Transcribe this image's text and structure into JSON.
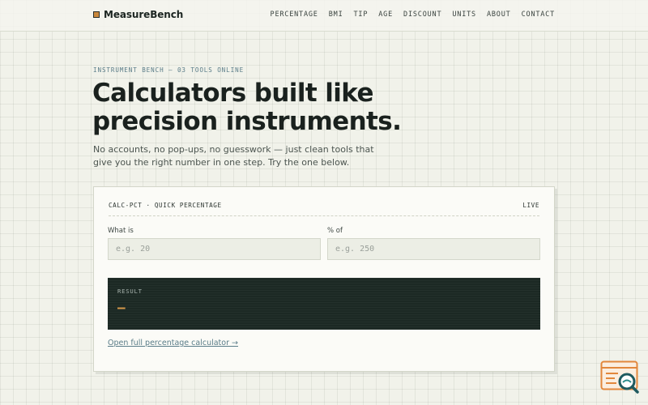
{
  "brand": {
    "name": "MeasureBench"
  },
  "nav": {
    "items": [
      "PERCENTAGE",
      "BMI",
      "TIP",
      "AGE",
      "DISCOUNT",
      "UNITS",
      "ABOUT",
      "CONTACT"
    ]
  },
  "hero": {
    "eyebrow": "INSTRUMENT BENCH — 03 TOOLS ONLINE",
    "headline": "Calculators built like precision instruments.",
    "subtext": "No accounts, no pop-ups, no guesswork — just clean tools that give you the right number in one step. Try the one below."
  },
  "calculator": {
    "id_label": "CALC-PCT · QUICK PERCENTAGE",
    "status": "LIVE",
    "field1": {
      "label": "What is",
      "placeholder": "e.g. 20",
      "value": ""
    },
    "field2": {
      "label": "% of",
      "placeholder": "e.g. 250",
      "value": ""
    },
    "result": {
      "label": "RESULT",
      "value": "—"
    },
    "link": "Open full percentage calculator →"
  },
  "colors": {
    "accent": "#c9873c",
    "result_bg": "#1c2924",
    "link": "#5a7c88"
  },
  "icons": {
    "corner_widget": "search-browser-icon"
  }
}
